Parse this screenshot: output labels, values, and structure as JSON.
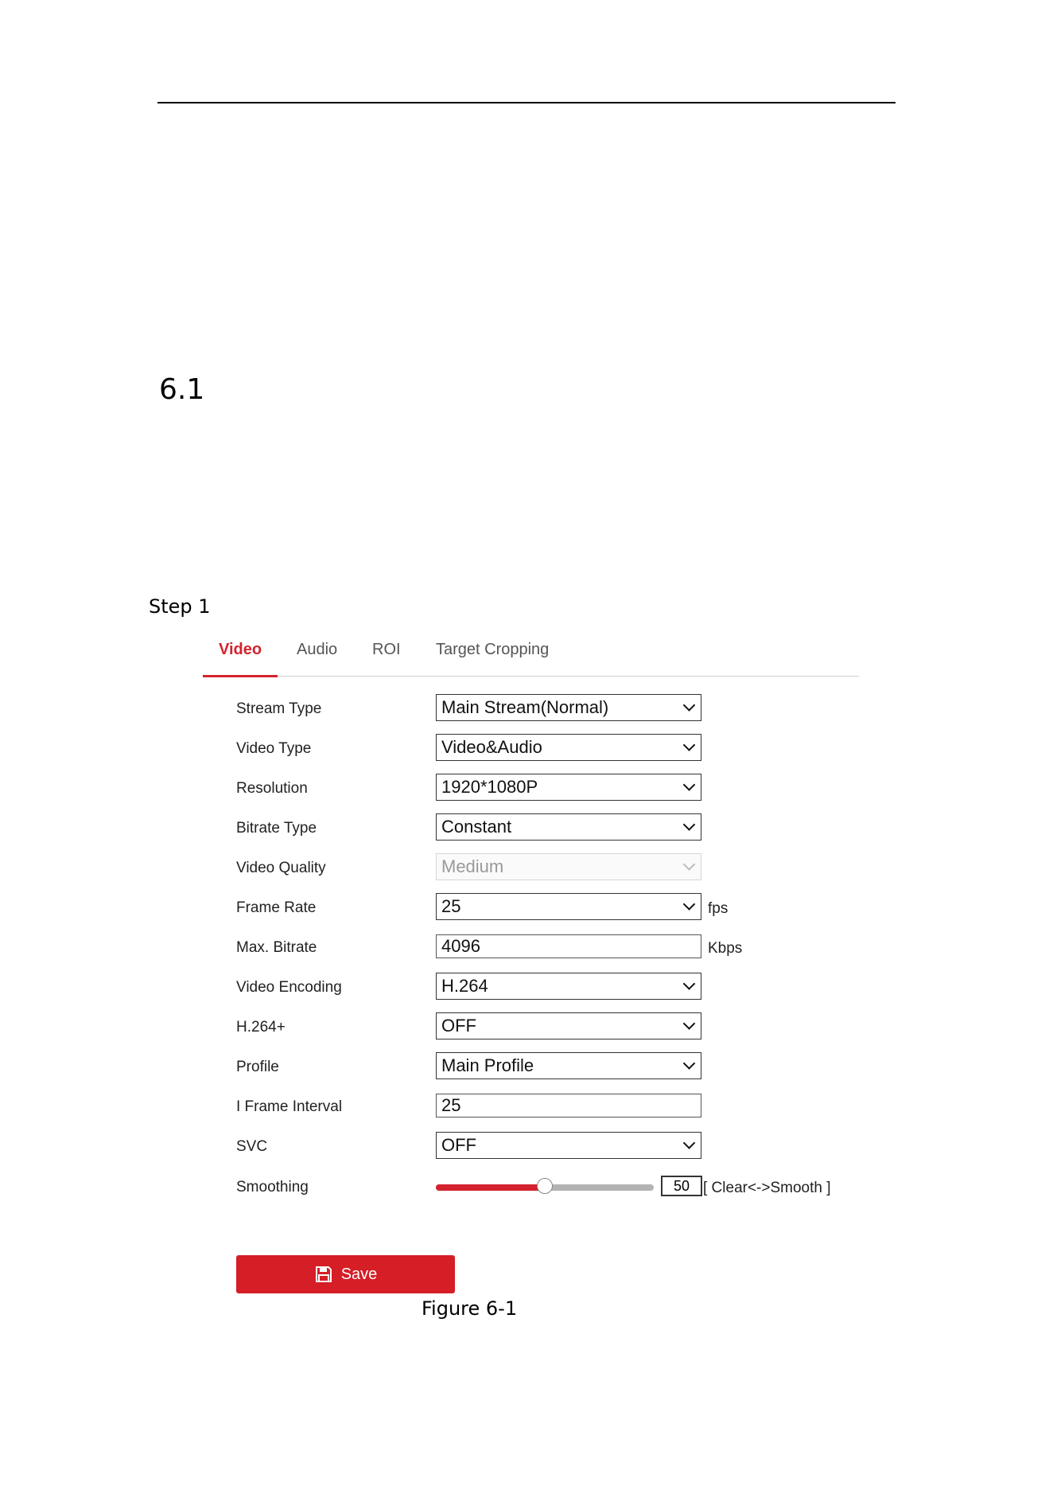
{
  "page": {
    "section_number": "6.1",
    "step_label": "Step 1",
    "caption": "Figure 6-1"
  },
  "tabs": [
    {
      "label": "Video",
      "active": true
    },
    {
      "label": "Audio",
      "active": false
    },
    {
      "label": "ROI",
      "active": false
    },
    {
      "label": "Target Cropping",
      "active": false
    }
  ],
  "form": {
    "stream_type": {
      "label": "Stream Type",
      "value": "Main Stream(Normal)"
    },
    "video_type": {
      "label": "Video Type",
      "value": "Video&Audio"
    },
    "resolution": {
      "label": "Resolution",
      "value": "1920*1080P"
    },
    "bitrate_type": {
      "label": "Bitrate Type",
      "value": "Constant"
    },
    "video_quality": {
      "label": "Video Quality",
      "value": "Medium",
      "disabled": true
    },
    "frame_rate": {
      "label": "Frame Rate",
      "value": "25",
      "unit": "fps"
    },
    "max_bitrate": {
      "label": "Max. Bitrate",
      "value": "4096",
      "unit": "Kbps"
    },
    "video_encoding": {
      "label": "Video Encoding",
      "value": "H.264"
    },
    "h264plus": {
      "label": "H.264+",
      "value": "OFF"
    },
    "profile": {
      "label": "Profile",
      "value": "Main Profile"
    },
    "i_frame_interval": {
      "label": "I Frame Interval",
      "value": "25"
    },
    "svc": {
      "label": "SVC",
      "value": "OFF"
    },
    "smoothing": {
      "label": "Smoothing",
      "value": "50",
      "level": 0.5,
      "range_hint": "[ Clear<->Smooth ]"
    }
  },
  "save": {
    "label": "Save",
    "icon": "save-icon"
  },
  "colors": {
    "accent": "#d4232e",
    "save_bg": "#d51e26"
  }
}
